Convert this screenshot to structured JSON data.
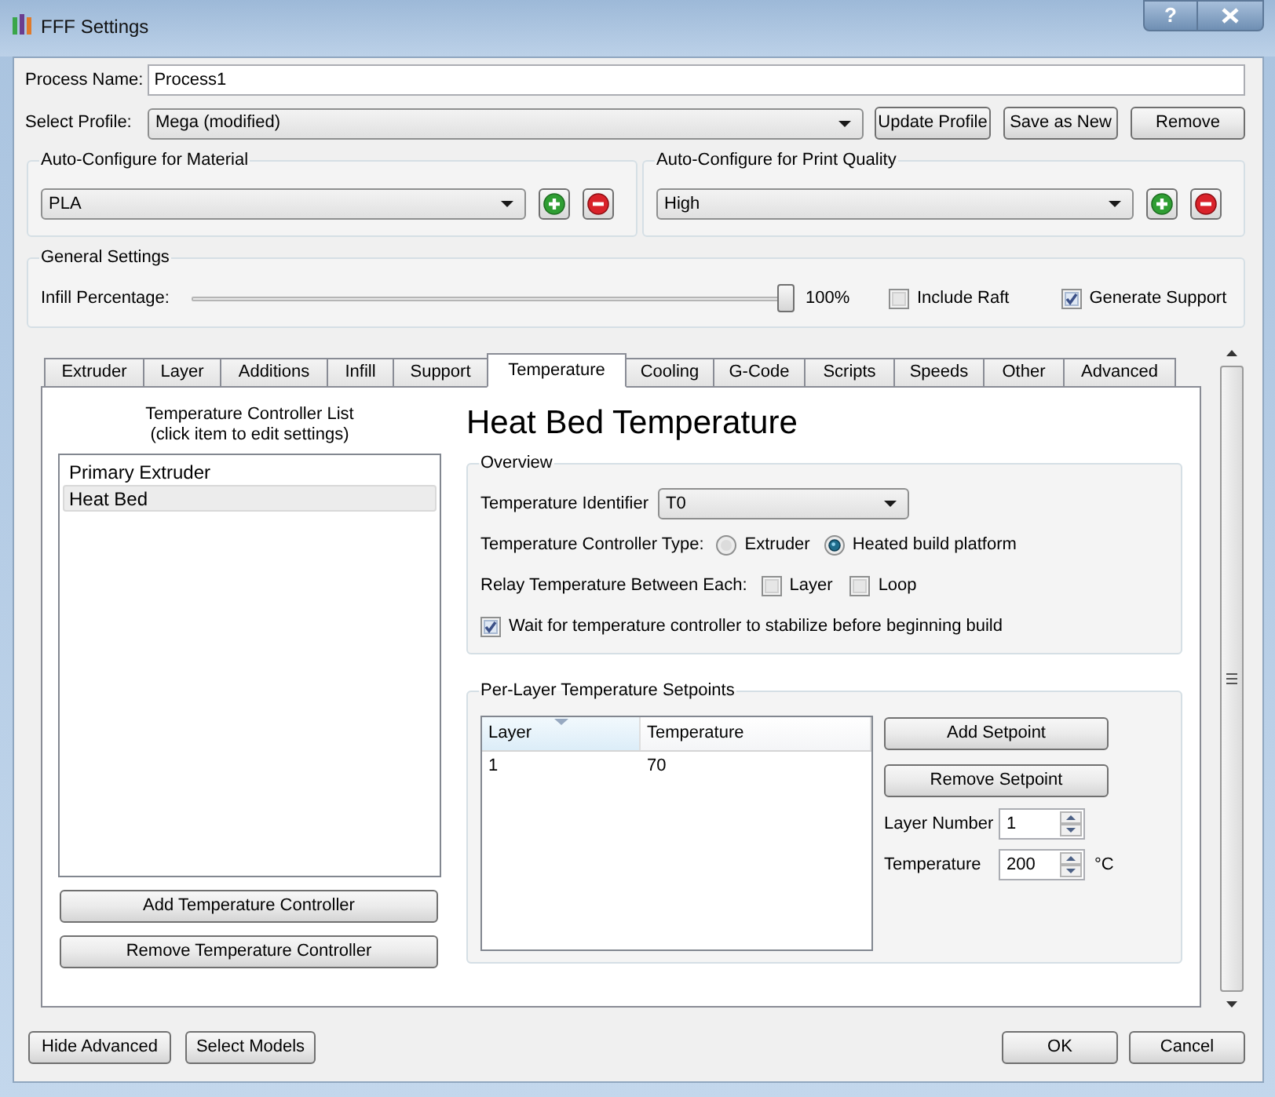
{
  "window": {
    "title": "FFF Settings",
    "help_button": "?"
  },
  "process_name": {
    "label": "Process Name:",
    "value": "Process1"
  },
  "profile": {
    "label": "Select Profile:",
    "value": "Mega (modified)",
    "buttons": [
      "Update Profile",
      "Save as New",
      "Remove"
    ]
  },
  "auto_configure": [
    {
      "title": "Auto-Configure for Material",
      "value": "PLA"
    },
    {
      "title": "Auto-Configure for Print Quality",
      "value": "High"
    }
  ],
  "general_settings": {
    "title": "General Settings",
    "infill": {
      "label": "Infill Percentage:",
      "level": 1,
      "reading": "100%"
    },
    "options": [
      {
        "label": "Include Raft",
        "checked": false
      },
      {
        "label": "Generate Support",
        "checked": true
      }
    ]
  },
  "tabs": [
    {
      "label": "Extruder",
      "selected": false
    },
    {
      "label": "Layer",
      "selected": false
    },
    {
      "label": "Additions",
      "selected": false
    },
    {
      "label": "Infill",
      "selected": false
    },
    {
      "label": "Support",
      "selected": false
    },
    {
      "label": "Temperature",
      "selected": true
    },
    {
      "label": "Cooling",
      "selected": false
    },
    {
      "label": "G-Code",
      "selected": false
    },
    {
      "label": "Scripts",
      "selected": false
    },
    {
      "label": "Speeds",
      "selected": false
    },
    {
      "label": "Other",
      "selected": false
    },
    {
      "label": "Advanced",
      "selected": false
    }
  ],
  "controller_list": {
    "title": "Temperature Controller List",
    "hint": "(click item to edit settings)",
    "items": [
      {
        "label": "Primary Extruder",
        "selected": false
      },
      {
        "label": "Heat Bed",
        "selected": true
      }
    ],
    "buttons": [
      "Add Temperature Controller",
      "Remove Temperature Controller"
    ]
  },
  "detail": {
    "heading": "Heat Bed Temperature",
    "overview": {
      "title": "Overview",
      "identifier": {
        "label": "Temperature Identifier",
        "value": "T0"
      },
      "controller_type": {
        "label": "Temperature Controller Type:",
        "options": [
          {
            "label": "Extruder",
            "selected": false
          },
          {
            "label": "Heated build platform",
            "selected": true
          }
        ]
      },
      "relay": {
        "label": "Relay Temperature Between Each:",
        "options": [
          {
            "label": "Layer",
            "checked": false
          },
          {
            "label": "Loop",
            "checked": false
          }
        ]
      },
      "wait": {
        "label": "Wait for temperature controller to stabilize before beginning build",
        "checked": true
      }
    },
    "setpoints": {
      "title": "Per-Layer Temperature Setpoints",
      "table": {
        "columns": [
          {
            "label": "Layer",
            "sorted": true
          },
          {
            "label": "Temperature",
            "sorted": false
          }
        ],
        "rows": [
          [
            "1",
            "70"
          ]
        ]
      },
      "buttons": [
        "Add Setpoint",
        "Remove Setpoint"
      ],
      "fields": [
        {
          "label": "Layer Number",
          "value": "1"
        },
        {
          "label": "Temperature",
          "value": "200",
          "unit": "°C"
        }
      ]
    }
  },
  "footer": {
    "left_buttons": [
      "Hide Advanced",
      "Select Models"
    ],
    "right_buttons": [
      "OK",
      "Cancel"
    ]
  }
}
